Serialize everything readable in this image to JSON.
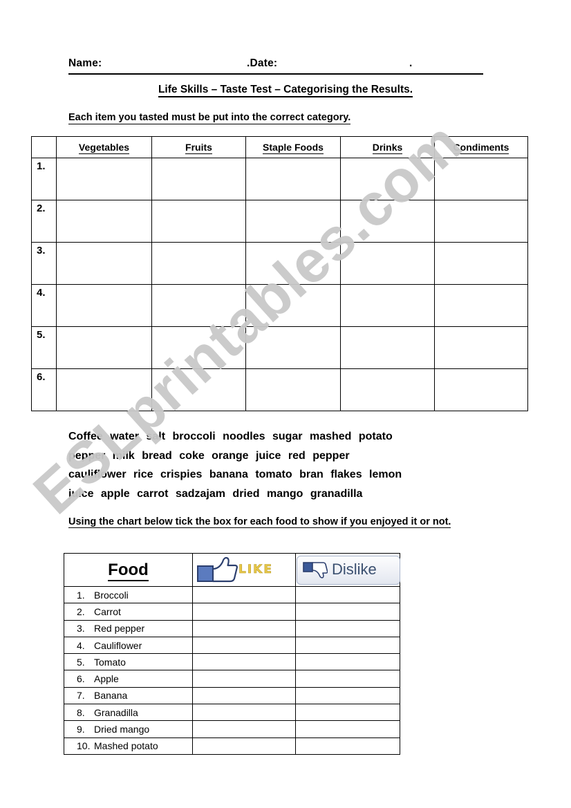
{
  "watermark": {
    "text": "ESLprintables.com"
  },
  "header": {
    "name_label": "Name:",
    "date_label": ".Date:",
    "trailing_dot": ".",
    "title": "Life Skills – Taste Test – Categorising the Results."
  },
  "instructions": {
    "first": "Each item you tasted must be put into the correct category.",
    "second": "Using the chart below tick the box for each food to show if you enjoyed it or not."
  },
  "category_table": {
    "columns": [
      "",
      "Vegetables",
      "Fruits",
      "Staple Foods",
      "Drinks",
      "Condiments"
    ],
    "row_numbers": [
      "1.",
      "2.",
      "3.",
      "4.",
      "5.",
      "6."
    ]
  },
  "word_list": {
    "lines": [
      "Coffee    water    salt    broccoli    noodles    sugar     mashed potato",
      "pepper    milk    bread    coke    orange juice    red pepper",
      "cauliflower    rice crispies    banana    tomato    bran flakes    lemon",
      "juice    apple    carrot    sadzajam    dried mango    granadilla"
    ],
    "words": [
      "Coffee",
      "water",
      "salt",
      "broccoli",
      "noodles",
      "sugar",
      "mashed potato",
      "pepper",
      "milk",
      "bread",
      "coke",
      "orange juice",
      "red pepper",
      "cauliflower",
      "rice crispies",
      "banana",
      "tomato",
      "bran flakes",
      "lemon juice",
      "apple",
      "carrot",
      "sadzajam",
      "dried mango",
      "granadilla"
    ]
  },
  "food_table": {
    "header_food": "Food",
    "header_like": "LIKE",
    "header_dislike": "Dislike",
    "rows": [
      {
        "index": "1.",
        "name": "Broccoli"
      },
      {
        "index": "2.",
        "name": "Carrot"
      },
      {
        "index": "3.",
        "name": "Red pepper"
      },
      {
        "index": "4.",
        "name": "Cauliflower"
      },
      {
        "index": "5.",
        "name": "Tomato"
      },
      {
        "index": "6.",
        "name": "Apple"
      },
      {
        "index": "7.",
        "name": "Banana"
      },
      {
        "index": "8.",
        "name": "Granadilla"
      },
      {
        "index": "9.",
        "name": "Dried mango"
      },
      {
        "index": "10.",
        "name": "Mashed potato"
      }
    ]
  },
  "colors": {
    "like_text": "#e8c84a",
    "thumb_blue": "#3b5998",
    "dislike_text": "#3b5070",
    "watermark": "#c9c9c9"
  }
}
